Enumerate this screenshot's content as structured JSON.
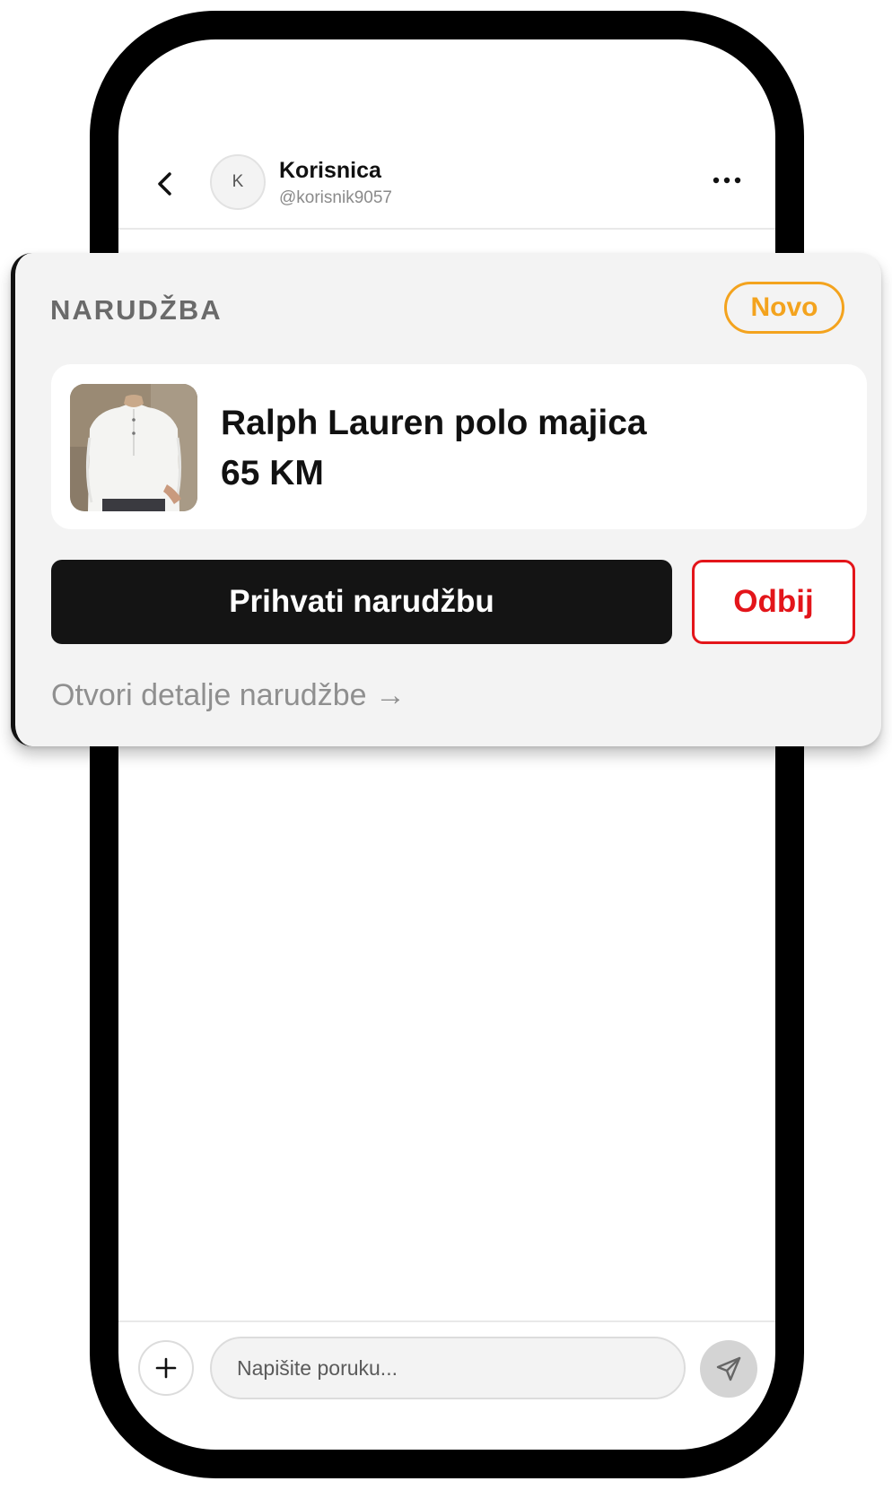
{
  "header": {
    "avatar_initial": "K",
    "user_name": "Korisnica",
    "user_handle": "@korisnik9057",
    "back_icon": "chevron-left-icon",
    "more_icon": "more-horizontal-icon"
  },
  "order": {
    "title": "NARUDŽBA",
    "status": "Novo",
    "product": {
      "name": "Ralph Lauren polo majica",
      "price": "65 KM"
    },
    "accept_label": "Prihvati narudžbu",
    "reject_label": "Odbij",
    "details_link": "Otvori detalje narudžbe →",
    "colors": {
      "status": "#f3a31e",
      "reject": "#e3151a",
      "accept_bg": "#141414"
    }
  },
  "composer": {
    "placeholder": "Napišite poruku...",
    "add_icon": "plus-icon",
    "send_icon": "send-icon"
  }
}
